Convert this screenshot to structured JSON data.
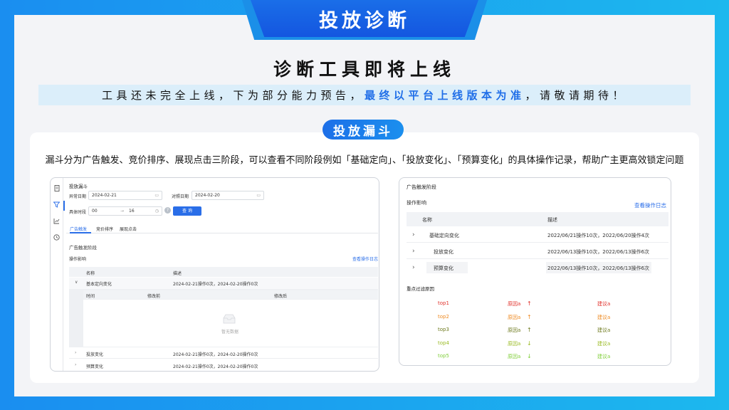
{
  "header": {
    "tab_title": "投放诊断"
  },
  "main": {
    "headline": "诊断工具即将上线",
    "notice": {
      "part1": "工具还未完全上线，下为部分能力预告，",
      "highlight": "最终以平台上线版本为准",
      "part2": "，请敬请期待！"
    },
    "section_pill": "投放漏斗",
    "description": "漏斗分为广告触发、竞价排序、展现点击三阶段，可以查看不同阶段例如「基础定向」、「投放变化」、「预算变化」的具体操作记录，帮助广主更高效锁定问题"
  },
  "left_shot": {
    "title": "投放漏斗",
    "filters": {
      "abnormal_date_label": "异常日期",
      "abnormal_date_value": "2024-02-21",
      "compare_date_label": "对照日期",
      "compare_date_value": "2024-02-20",
      "time_label": "具体时段",
      "time_from": "00",
      "time_to": "16",
      "time_sep": "→",
      "query_button": "查 询"
    },
    "tabs": [
      "广告触发",
      "竞价排序",
      "展现点击"
    ],
    "stage_title": "广告触发阶段",
    "impact_label": "操作影响",
    "view_log": "查看操作日志",
    "columns": [
      "名称",
      "描述"
    ],
    "rows": [
      {
        "name": "基本定向变化",
        "desc": "2024-02-21操作0次，2024-02-20操作0次"
      },
      {
        "name": "投放变化",
        "desc": "2024-02-21操作0次，2024-02-20操作0次"
      },
      {
        "name": "预算变化",
        "desc": "2024-02-21操作0次，2024-02-20操作0次"
      }
    ],
    "sub_columns": [
      "时间",
      "修改前",
      "修改后"
    ],
    "empty_text": "暂无数据"
  },
  "right_shot": {
    "stage_title": "广告触发阶段",
    "impact_label": "操作影响",
    "view_log": "查看操作日志",
    "columns": [
      "名称",
      "描述"
    ],
    "rows": [
      {
        "name": "基础定向变化",
        "desc": "2022/06/21操作10次，2022/06/20操作4次"
      },
      {
        "name": "投放变化",
        "desc": "2022/06/13操作10次，2022/06/13操作6次"
      },
      {
        "name": "预算变化",
        "desc": "2022/06/13操作10次，2022/06/13操作6次"
      }
    ],
    "reasons_title": "重点过滤原因",
    "reasons": [
      {
        "rank": "top1",
        "reason": "原因a",
        "arrow": "↑",
        "advice": "建议a",
        "color": "#e0302a"
      },
      {
        "rank": "top2",
        "reason": "原因a",
        "arrow": "↑",
        "advice": "建议a",
        "color": "#ee8a22"
      },
      {
        "rank": "top3",
        "reason": "原因a",
        "arrow": "↑",
        "advice": "建议a",
        "color": "#6e7a1e"
      },
      {
        "rank": "top4",
        "reason": "原因a",
        "arrow": "↓",
        "advice": "建议a",
        "color": "#9abb24"
      },
      {
        "rank": "top5",
        "reason": "原因a",
        "arrow": "↓",
        "advice": "建议a",
        "color": "#80cf3a"
      }
    ]
  }
}
